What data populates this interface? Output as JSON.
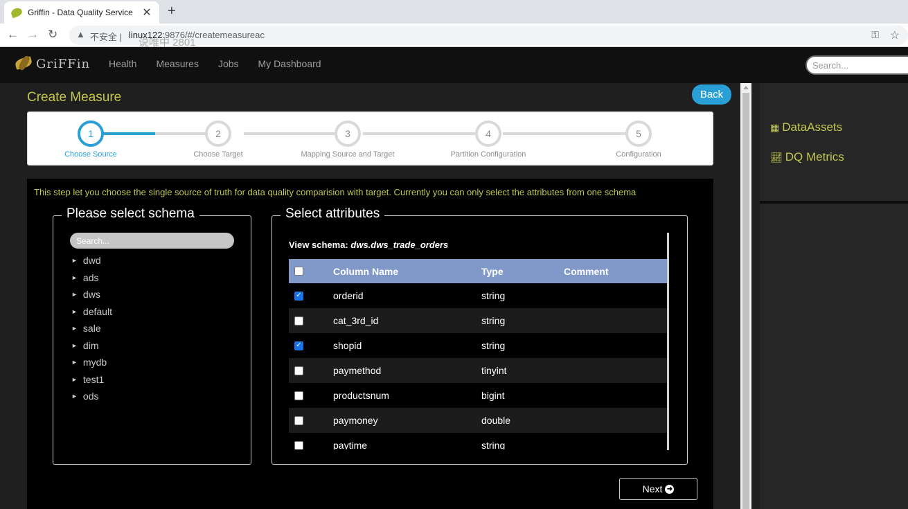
{
  "browser": {
    "tab_title": "Griffin - Data Quality Service",
    "tab_close": "✕",
    "new_tab": "+",
    "insecure_label": "不安全",
    "url_host": "linux122",
    "url_rest": ":9876/#/createmeasureac",
    "watermark": "说唯中 2801"
  },
  "app": {
    "brand": "GriFFin",
    "nav": [
      "Health",
      "Measures",
      "Jobs",
      "My Dashboard"
    ],
    "search_placeholder": "Search..."
  },
  "page": {
    "title": "Create Measure",
    "back_label": "Back",
    "steps": [
      {
        "num": "1",
        "label": "Choose Source",
        "active": true
      },
      {
        "num": "2",
        "label": "Choose Target",
        "active": false
      },
      {
        "num": "3",
        "label": "Mapping Source and Target",
        "active": false
      },
      {
        "num": "4",
        "label": "Partition Configuration",
        "active": false
      },
      {
        "num": "5",
        "label": "Configuration",
        "active": false
      }
    ],
    "hint": "This step let you choose the single source of truth for data quality comparision with target. Currently you can only select the attributes from one schema",
    "next_label": "Next"
  },
  "schema_panel": {
    "legend": "Please select schema",
    "search_placeholder": "Search...",
    "items": [
      "dwd",
      "ads",
      "dws",
      "default",
      "sale",
      "dim",
      "mydb",
      "test1",
      "ods"
    ]
  },
  "attributes_panel": {
    "legend": "Select attributes",
    "view_schema_label": "View schema:",
    "view_schema_value": "dws.dws_trade_orders",
    "columns": {
      "name": "Column Name",
      "type": "Type",
      "comment": "Comment"
    },
    "rows": [
      {
        "name": "orderid",
        "type": "string",
        "comment": "",
        "checked": true
      },
      {
        "name": "cat_3rd_id",
        "type": "string",
        "comment": "",
        "checked": false
      },
      {
        "name": "shopid",
        "type": "string",
        "comment": "",
        "checked": true
      },
      {
        "name": "paymethod",
        "type": "tinyint",
        "comment": "",
        "checked": false
      },
      {
        "name": "productsnum",
        "type": "bigint",
        "comment": "",
        "checked": false
      },
      {
        "name": "paymoney",
        "type": "double",
        "comment": "",
        "checked": false
      },
      {
        "name": "paytime",
        "type": "string",
        "comment": "",
        "checked": false
      }
    ]
  },
  "sidebar": {
    "links": [
      {
        "icon": "table-icon",
        "label": "DataAssets"
      },
      {
        "icon": "line-chart-icon",
        "label": "DQ Metrics"
      }
    ]
  },
  "colors": {
    "accent_yellow": "#c2c84d",
    "accent_blue": "#2a9fd6",
    "table_header": "#8099c9"
  }
}
